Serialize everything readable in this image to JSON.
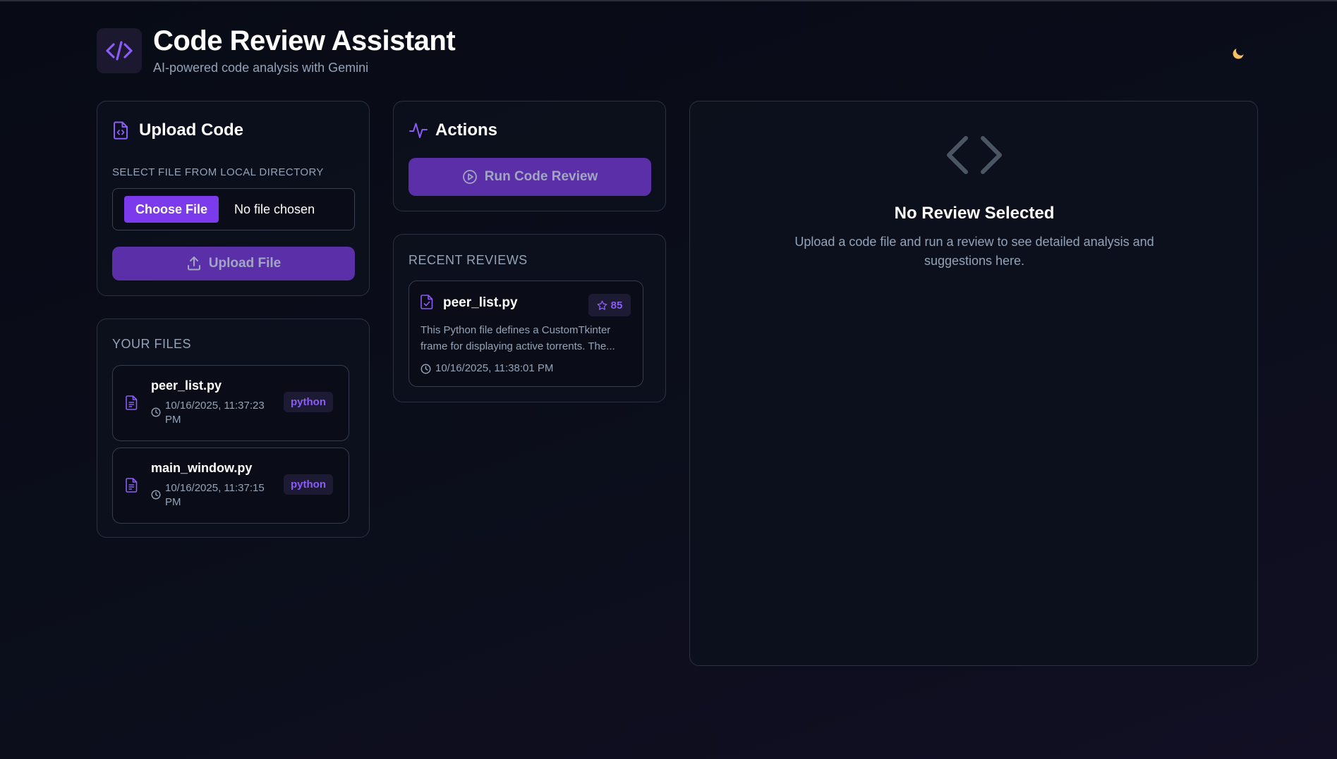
{
  "header": {
    "title": "Code Review Assistant",
    "subtitle": "AI-powered code analysis with Gemini",
    "logo_icon": "code-icon",
    "theme_icon": "moon-icon"
  },
  "upload": {
    "title": "Upload Code",
    "label": "SELECT FILE FROM LOCAL DIRECTORY",
    "choose_label": "Choose File",
    "no_file_text": "No file chosen",
    "upload_label": "Upload File"
  },
  "files": {
    "title": "YOUR FILES",
    "items": [
      {
        "name": "peer_list.py",
        "date": "10/16/2025, 11:37:23 PM",
        "lang": "python"
      },
      {
        "name": "main_window.py",
        "date": "10/16/2025, 11:37:15 PM",
        "lang": "python"
      }
    ]
  },
  "actions": {
    "title": "Actions",
    "run_label": "Run Code Review"
  },
  "recent": {
    "title": "RECENT REVIEWS",
    "items": [
      {
        "name": "peer_list.py",
        "score": "85",
        "description": "This Python file defines a CustomTkinter frame for displaying active torrents. The...",
        "date": "10/16/2025, 11:38:01 PM"
      }
    ]
  },
  "review_panel": {
    "title": "No Review Selected",
    "description": "Upload a code file and run a review to see detailed analysis and suggestions here."
  },
  "colors": {
    "accent": "#7c3aed",
    "accent_dark": "#5b2fa8",
    "background": "#0b0e1b",
    "muted_text": "#94a3b8"
  }
}
